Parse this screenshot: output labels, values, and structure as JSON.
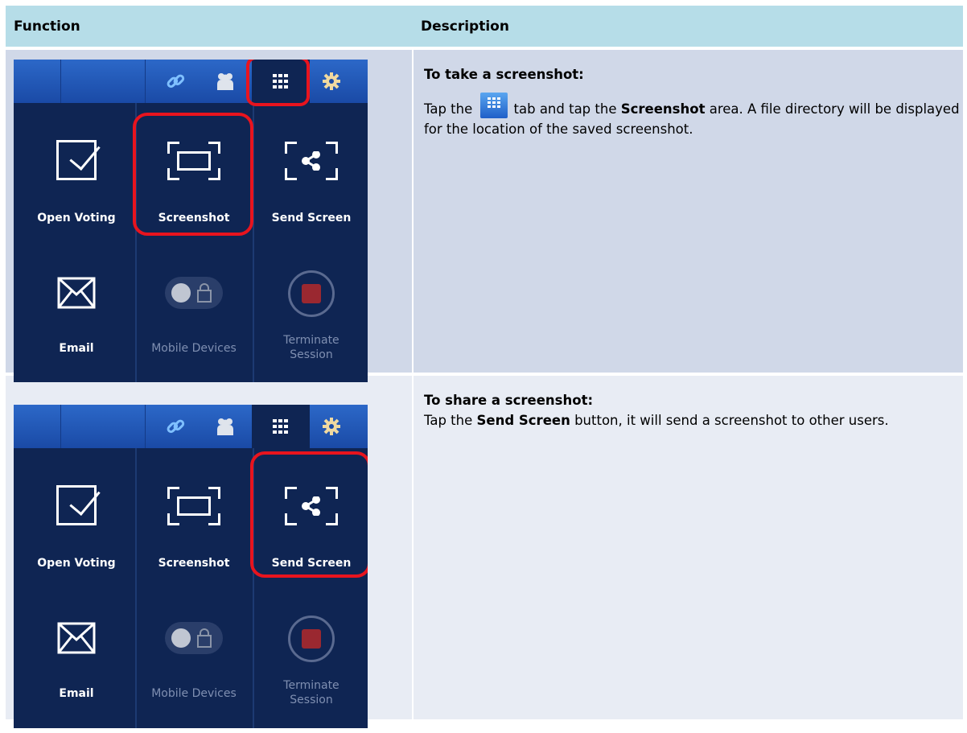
{
  "table": {
    "headers": {
      "function": "Function",
      "description": "Description"
    },
    "rows": [
      {
        "heading": "To take a screenshot:",
        "text_before": "Tap the",
        "text_mid": "tab and tap the",
        "bold_term": "Screenshot",
        "text_after": "area. A file directory will be displayed for the location of the saved screenshot.",
        "inline_icon": "grid-tab-icon",
        "highlighted_item": "Screenshot"
      },
      {
        "heading": "To share a screenshot:",
        "text_before": "Tap the",
        "bold_term": "Send Screen",
        "text_after": "button, it will send a screenshot to other users.",
        "highlighted_item": "Send Screen"
      }
    ]
  },
  "panel": {
    "tiles": {
      "open_voting": "Open Voting",
      "screenshot": "Screenshot",
      "send_screen": "Send Screen",
      "email": "Email",
      "mobile_devices": "Mobile Devices",
      "terminate_line1": "Terminate",
      "terminate_line2": "Session"
    },
    "toolbar_icons": [
      "link-icon",
      "users-icon",
      "grid-icon",
      "gear-icon"
    ]
  },
  "colors": {
    "header_bg": "#b6dde8",
    "row1_bg": "#d0d8e8",
    "row2_bg": "#e8ecf4",
    "panel_bg": "#0f2553",
    "highlight": "#e8141e"
  }
}
